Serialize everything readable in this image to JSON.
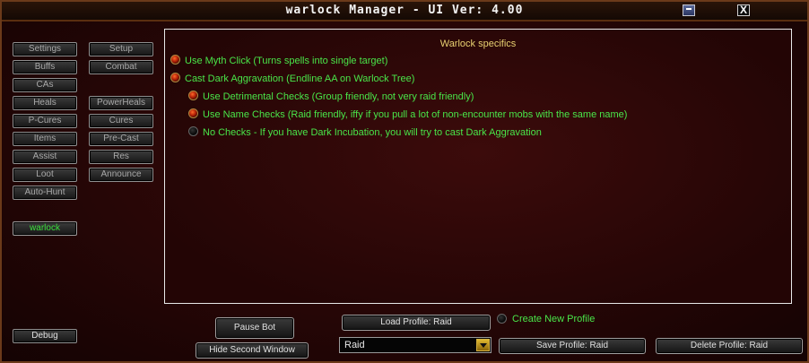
{
  "window": {
    "title": "warlock Manager   - UI Ver: 4.00",
    "minimize_label": "",
    "close_label": "X"
  },
  "sidebar": {
    "left": [
      "Settings",
      "Buffs",
      "CAs",
      "Heals",
      "P-Cures",
      "Items",
      "Assist",
      "Loot",
      "Auto-Hunt"
    ],
    "right": [
      "Setup",
      "Combat",
      "PowerHeals",
      "Cures",
      "Pre-Cast",
      "Res",
      "Announce"
    ],
    "class_tab": "warlock",
    "debug": "Debug"
  },
  "content": {
    "title": "Warlock specifics",
    "options": [
      {
        "label": "Use Myth Click (Turns spells into single target)",
        "checked": true
      },
      {
        "label": "Cast Dark Aggravation (Endline AA on Warlock Tree)",
        "checked": true
      },
      {
        "label": "Use Detrimental Checks (Group friendly, not very raid friendly)",
        "checked": true
      },
      {
        "label": "Use Name Checks (Raid friendly, iffy if you pull a lot of non-encounter mobs with the same name)",
        "checked": true
      },
      {
        "label": "No Checks - If you have Dark Incubation, you will try to cast Dark Aggravation",
        "checked": false
      }
    ]
  },
  "footer": {
    "pause_bot": "Pause Bot",
    "hide_second_window": "Hide Second Window",
    "load_profile": "Load Profile: Raid",
    "profile_value": "Raid",
    "create_new_profile": "Create New Profile",
    "save_profile": "Save Profile: Raid",
    "delete_profile": "Delete Profile: Raid"
  }
}
